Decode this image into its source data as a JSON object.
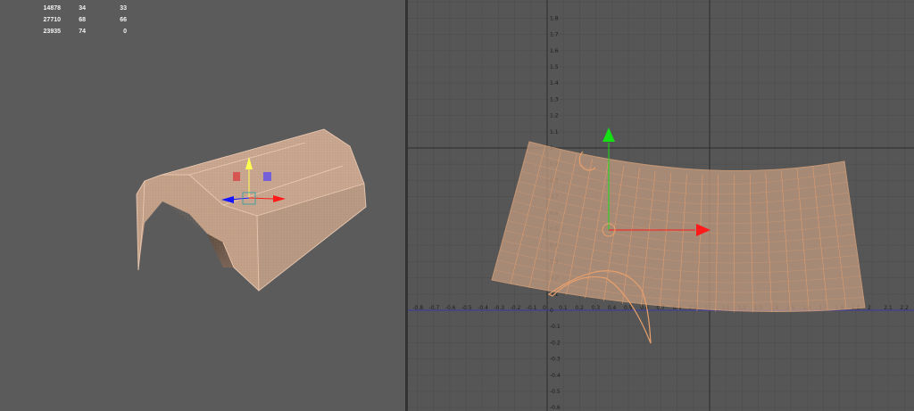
{
  "hud": {
    "rows": [
      [
        "14878",
        "34",
        "33"
      ],
      [
        "27710",
        "68",
        "66"
      ],
      [
        "23935",
        "74",
        "0"
      ]
    ]
  },
  "colors": {
    "mesh_fill": "#c7a38a",
    "mesh_wire": "#e6a473",
    "grid": "#4e4e4e",
    "axis_major": "#2c2c2c",
    "axis_x": "#3b3ba8",
    "manip_x": "#ff1a1a",
    "manip_y": "#14e014",
    "manip_z": "#1414ff",
    "manip_y_persp": "#ffff50"
  },
  "uv_axis": {
    "y_ticks": [
      "1.8",
      "1.7",
      "1.6",
      "1.5",
      "1.4",
      "1.3",
      "1.2",
      "1.1",
      "1",
      "0.9",
      "0.8",
      "0.7",
      "0.6",
      "0.5",
      "0.4",
      "0.3",
      "0.2",
      "0.1",
      "0",
      "-0.1",
      "-0.2",
      "-0.3",
      "-0.4",
      "-0.5",
      "-0.6"
    ],
    "x_ticks": [
      "-0.9",
      "-0.8",
      "-0.7",
      "-0.6",
      "-0.5",
      "-0.4",
      "-0.3",
      "-0.2",
      "-0.1",
      "0",
      "0.1",
      "0.2",
      "0.3",
      "0.4",
      "0.5",
      "0.6",
      "0.7",
      "0.8",
      "0.9",
      "1",
      "1.1",
      "1.2",
      "1.3",
      "1.4",
      "1.5",
      "1.6",
      "1.7",
      "1.8",
      "1.9",
      "2",
      "2.1",
      "2.2"
    ]
  },
  "icons": [
    "move-manipulator-icon",
    "scale-manipulator-icon"
  ]
}
